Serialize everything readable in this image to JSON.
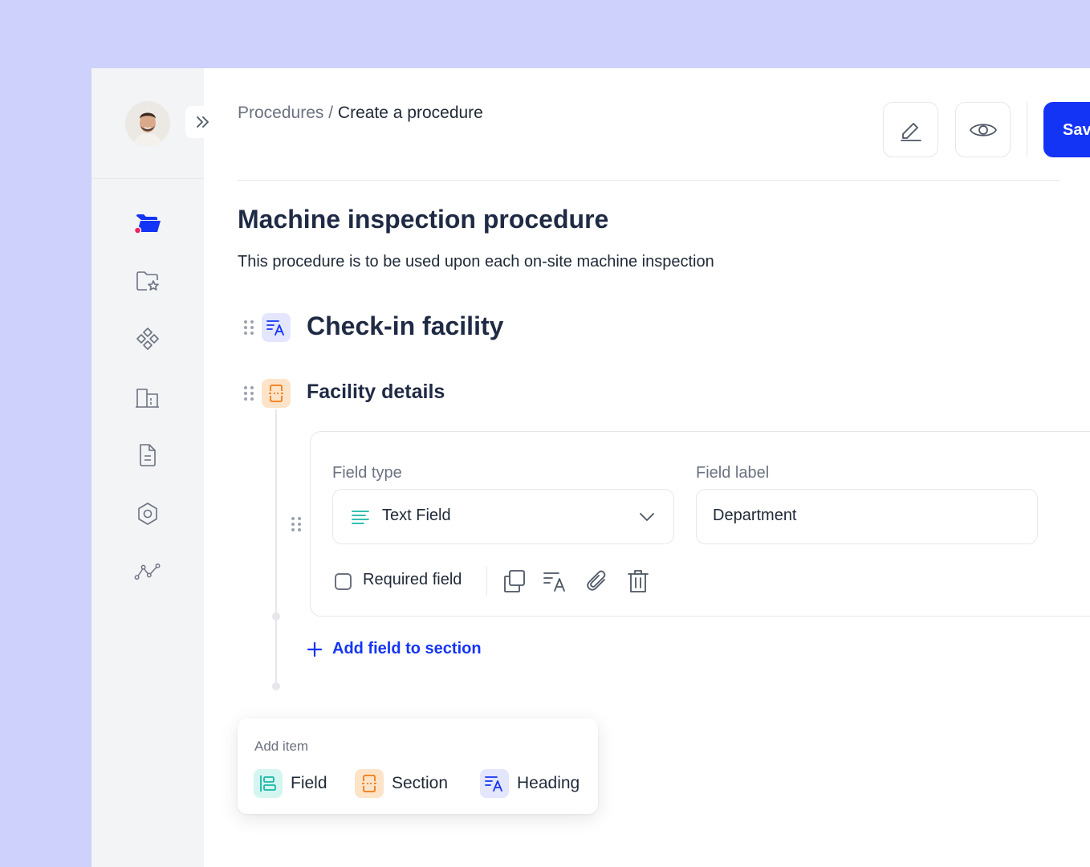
{
  "breadcrumb": {
    "parent": "Procedures",
    "separator": " / ",
    "current": "Create a procedure"
  },
  "toolbar": {
    "save_label": "Save",
    "edit_icon": "pen-icon",
    "preview_icon": "eye-icon"
  },
  "sidebar": {
    "expand_icon": "chevrons-right-icon",
    "items": [
      {
        "icon": "folder-open-icon",
        "active": true
      },
      {
        "icon": "folder-star-icon",
        "active": false
      },
      {
        "icon": "components-icon",
        "active": false
      },
      {
        "icon": "building-icon",
        "active": false
      },
      {
        "icon": "document-icon",
        "active": false
      },
      {
        "icon": "hexagon-settings-icon",
        "active": false
      },
      {
        "icon": "analytics-icon",
        "active": false
      }
    ]
  },
  "procedure": {
    "title": "Machine inspection procedure",
    "description": "This procedure is to be used upon each on-site machine inspection"
  },
  "heading_block": {
    "text": "Check-in facility"
  },
  "section_block": {
    "text": "Facility details"
  },
  "field_card": {
    "field_type_label": "Field type",
    "field_type_value": "Text Field",
    "field_label_label": "Field label",
    "field_label_value": "Department",
    "required_label": "Required field",
    "required_checked": false
  },
  "add_field_label": "Add field to section",
  "add_item": {
    "title": "Add item",
    "options": [
      {
        "label": "Field",
        "icon": "field-icon"
      },
      {
        "label": "Section",
        "icon": "section-icon"
      },
      {
        "label": "Heading",
        "icon": "heading-icon"
      }
    ]
  },
  "colors": {
    "accent": "#1434f5",
    "background": "#cdd1fb",
    "field_badge": "#d5f5f0",
    "section_badge": "#fde3c8",
    "heading_badge": "#e3e6fc"
  }
}
